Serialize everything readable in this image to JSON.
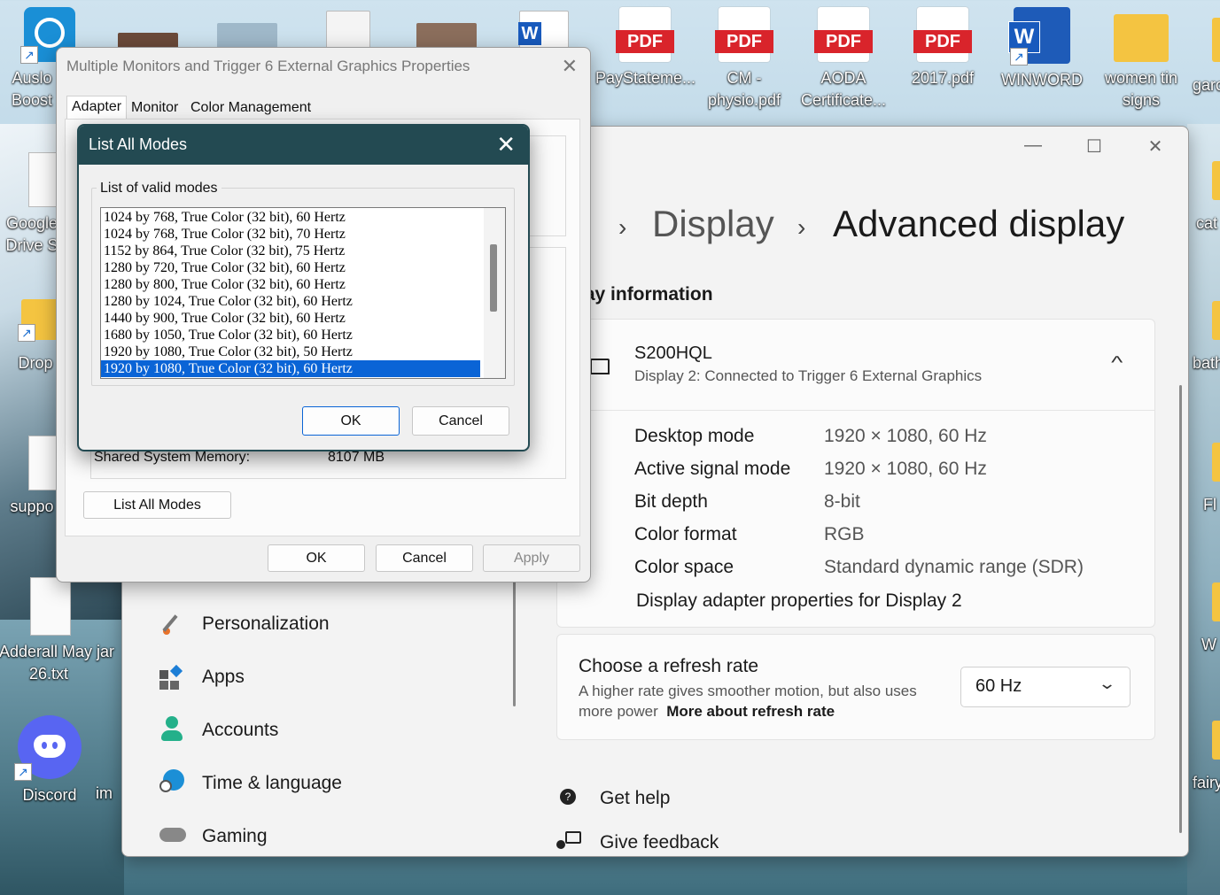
{
  "desktop": {
    "left_icons": [
      {
        "label1": "Auslo",
        "label2": "Boost"
      },
      {
        "label1": "Google",
        "label2": "Drive S"
      },
      {
        "label1": "Drop",
        "label2": ""
      },
      {
        "label1": "suppo",
        "label2": ""
      },
      {
        "label1": "Adderall May jar",
        "label2": "26.txt"
      },
      {
        "label1": "Discord",
        "label2": ""
      }
    ],
    "left_partial_text": "im",
    "top_icons": [
      {
        "label1": "PayStateme...",
        "label2": "",
        "type": "pdf"
      },
      {
        "label1": "CM -",
        "label2": "physio.pdf",
        "type": "pdf"
      },
      {
        "label1": "AODA",
        "label2": "Certificate...",
        "type": "pdf"
      },
      {
        "label1": "2017.pdf",
        "label2": "",
        "type": "pdf"
      },
      {
        "label1": "WINWORD",
        "label2": "",
        "type": "word"
      },
      {
        "label1": "women tin",
        "label2": "signs",
        "type": "folder"
      }
    ],
    "pdf_badge": "PDF",
    "word_badge": "W",
    "right_partial": [
      "garc",
      "cat",
      "bath",
      "Fl",
      "W",
      "fairy"
    ]
  },
  "settings": {
    "breadcrumb_display": "Display",
    "breadcrumb_current": "Advanced display",
    "section_title": "lay information",
    "monitor": {
      "name": "S200HQL",
      "subtitle": "Display 2: Connected to Trigger 6 External Graphics"
    },
    "rows": [
      {
        "label": "Desktop mode",
        "value": "1920 × 1080, 60 Hz"
      },
      {
        "label": "Active signal mode",
        "value": "1920 × 1080, 60 Hz"
      },
      {
        "label": "Bit depth",
        "value": "8-bit"
      },
      {
        "label": "Color format",
        "value": "RGB"
      },
      {
        "label": "Color space",
        "value": "Standard dynamic range (SDR)"
      }
    ],
    "adapter_link": "Display adapter properties for Display 2",
    "refresh": {
      "title": "Choose a refresh rate",
      "subtitle": "A higher rate gives smoother motion, but also uses more power",
      "link": "More about refresh rate",
      "selected": "60 Hz"
    },
    "nav": [
      "Personalization",
      "Apps",
      "Accounts",
      "Time & language",
      "Gaming"
    ],
    "help": [
      "Get help",
      "Give feedback"
    ]
  },
  "properties": {
    "title": "Multiple Monitors and Trigger 6 External Graphics Properties",
    "tabs": [
      "Adapter",
      "Monitor",
      "Color Management"
    ],
    "shared_memory_label": "Shared System Memory:",
    "shared_memory_value": "8107 MB",
    "list_all_modes": "List All Modes",
    "ok": "OK",
    "cancel": "Cancel",
    "apply": "Apply"
  },
  "modes_dialog": {
    "title": "List All Modes",
    "group_label": "List of valid modes",
    "modes": [
      "1024 by 768, True Color (32 bit), 60 Hertz",
      "1024 by 768, True Color (32 bit), 70 Hertz",
      "1152 by 864, True Color (32 bit), 75 Hertz",
      "1280 by 720, True Color (32 bit), 60 Hertz",
      "1280 by 800, True Color (32 bit), 60 Hertz",
      "1280 by 1024, True Color (32 bit), 60 Hertz",
      "1440 by 900, True Color (32 bit), 60 Hertz",
      "1680 by 1050, True Color (32 bit), 60 Hertz",
      "1920 by 1080, True Color (32 bit), 50 Hertz",
      "1920 by 1080, True Color (32 bit), 60 Hertz"
    ],
    "selected_index": 9,
    "ok": "OK",
    "cancel": "Cancel"
  },
  "colors": {
    "accent": "#0a64d6",
    "dialog_titlebar": "#234a52"
  }
}
